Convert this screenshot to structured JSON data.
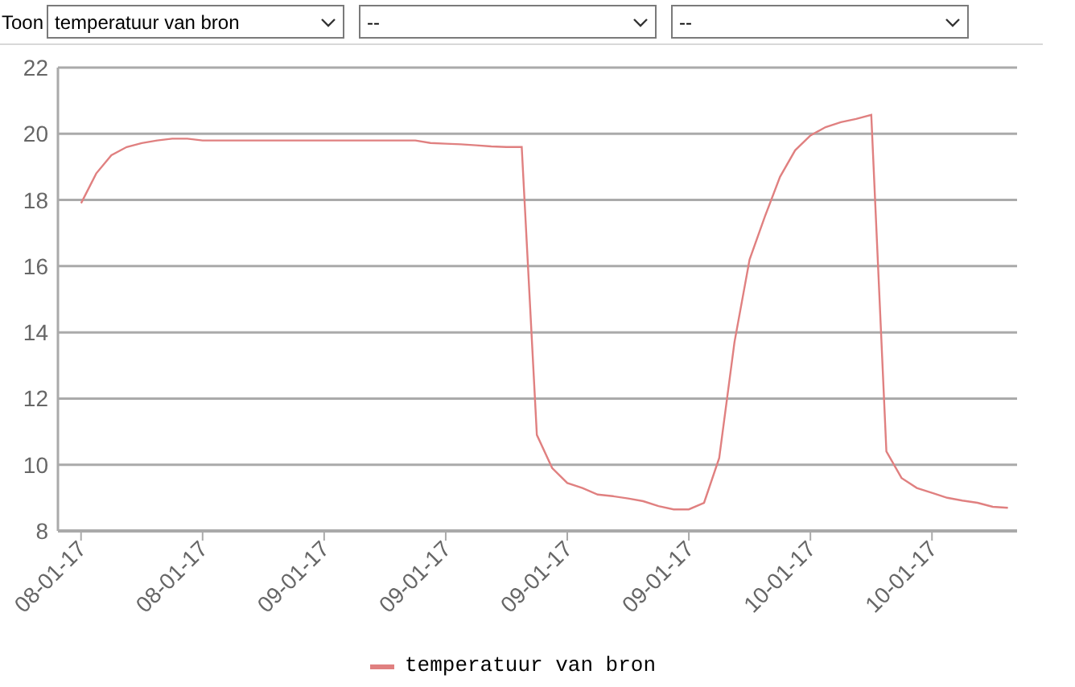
{
  "filter": {
    "label": "Toon",
    "selects": [
      {
        "value": "temperatuur van bron"
      },
      {
        "value": "--"
      },
      {
        "value": "--"
      }
    ]
  },
  "chart": {
    "chart_data": {
      "type": "line",
      "grid": true,
      "ylim": [
        8,
        22
      ],
      "yticks": [
        8,
        10,
        12,
        14,
        16,
        18,
        20,
        22
      ],
      "categories": [
        "08-01-17",
        null,
        null,
        null,
        null,
        null,
        null,
        null,
        "08-01-17",
        null,
        null,
        null,
        null,
        null,
        null,
        null,
        "09-01-17",
        null,
        null,
        null,
        null,
        null,
        null,
        null,
        "09-01-17",
        null,
        null,
        null,
        null,
        null,
        null,
        null,
        "09-01-17",
        null,
        null,
        null,
        null,
        null,
        null,
        null,
        "09-01-17",
        null,
        null,
        null,
        null,
        null,
        null,
        null,
        "10-01-17",
        null,
        null,
        null,
        null,
        null,
        null,
        null,
        "10-01-17",
        null,
        null,
        null,
        null,
        null
      ],
      "series": [
        {
          "name": "temperatuur van bron",
          "color": "#e08080",
          "values": [
            17.9,
            18.8,
            19.35,
            19.6,
            19.72,
            19.8,
            19.85,
            19.85,
            19.8,
            19.8,
            19.8,
            19.8,
            19.8,
            19.8,
            19.8,
            19.8,
            19.8,
            19.8,
            19.8,
            19.8,
            19.8,
            19.8,
            19.8,
            19.72,
            19.7,
            19.68,
            19.65,
            19.62,
            19.6,
            19.6,
            10.9,
            9.9,
            9.45,
            9.3,
            9.1,
            9.05,
            8.98,
            8.9,
            8.75,
            8.65,
            8.65,
            8.85,
            10.2,
            13.7,
            16.2,
            17.5,
            18.7,
            19.5,
            19.95,
            20.2,
            20.35,
            20.45,
            20.57,
            10.4,
            9.6,
            9.3,
            9.15,
            9.0,
            8.92,
            8.85,
            8.73,
            8.7
          ]
        }
      ]
    }
  }
}
